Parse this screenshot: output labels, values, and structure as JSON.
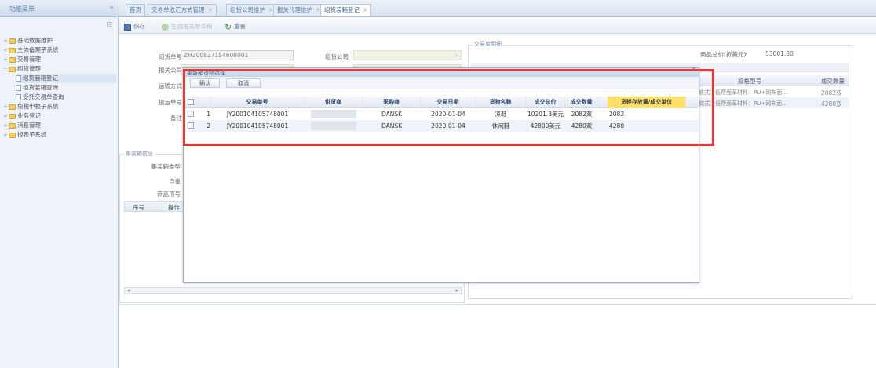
{
  "sidebar": {
    "title": "功能菜单",
    "collapse_glyph": "«",
    "items": [
      {
        "label": "基础数据维护",
        "level": 0
      },
      {
        "label": "主体备案子系统",
        "level": 0
      },
      {
        "label": "交易管理",
        "level": 0
      },
      {
        "label": "组货管理",
        "level": 0
      },
      {
        "label": "组货装箱登记",
        "level": 1,
        "selected": true
      },
      {
        "label": "组货装箱查询",
        "level": 1
      },
      {
        "label": "受托交易单查询",
        "level": 1
      },
      {
        "label": "免税申报子系统",
        "level": 0
      },
      {
        "label": "业务登记",
        "level": 0
      },
      {
        "label": "消息管理",
        "level": 0
      },
      {
        "label": "报表子系统",
        "level": 0
      }
    ]
  },
  "tabs": [
    {
      "label": "首页",
      "closable": false
    },
    {
      "label": "交易单收汇方式管理",
      "closable": true
    },
    {
      "label": "组货公司维护",
      "closable": true
    },
    {
      "label": "报关代理维护",
      "closable": true
    },
    {
      "label": "组货装箱登记",
      "closable": true,
      "active": true
    }
  ],
  "toolbar": {
    "save_label": "保存",
    "generate_label": "生成报关单草稿",
    "reset_label": "重置"
  },
  "form": {
    "order_no_label": "组货单号",
    "order_no_value": "ZH200827154608001",
    "company_label": "组货公司",
    "customs_label": "报关公司",
    "transport_label": "运输方式",
    "bill_label": "提运单号",
    "remark_label": "备注"
  },
  "container_section": {
    "legend": "集装箱信息",
    "type_label": "集装箱类型",
    "weight_label": "自重",
    "items_label": "商品项号",
    "col_no": "序号",
    "col_op": "操作"
  },
  "right_panel": {
    "legend": "交易单明细",
    "total_label": "商品总价(折美元):",
    "total_value": "53001.80",
    "col_spec": "规格型号",
    "col_qty": "成交数量",
    "rows": [
      {
        "spec": "款式：低帮面革材料：PU+网布面...",
        "qty": "2082双"
      },
      {
        "spec": "款式：低帮面革材料：PU+网布面...",
        "qty": "4280双"
      }
    ]
  },
  "modal": {
    "title": "集装箱货物选择",
    "close_glyph": "×",
    "confirm_label": "确认",
    "cancel_label": "取消",
    "columns": [
      "交易单号",
      "供货商",
      "采购商",
      "交易日期",
      "货物名称",
      "成交总价",
      "成交数量",
      "货柜存放量/成交单位"
    ],
    "rows": [
      {
        "index": "1",
        "order": "JY200104105748001",
        "supplier": "",
        "buyer": "DANSK",
        "date": "2020-01-04",
        "goods": "凉鞋",
        "total": "10201.8美元",
        "qty": "2082双",
        "load": "2082"
      },
      {
        "index": "2",
        "order": "JY200104105748001",
        "supplier": "",
        "buyer": "DANSK",
        "date": "2020-01-04",
        "goods": "休闲鞋",
        "total": "42800美元",
        "qty": "4280双",
        "load": "4280"
      }
    ]
  },
  "colors": {
    "highlight_box": "#e53935",
    "header_highlight": "#ffe066",
    "theme_blue": "#5d7fa8"
  }
}
